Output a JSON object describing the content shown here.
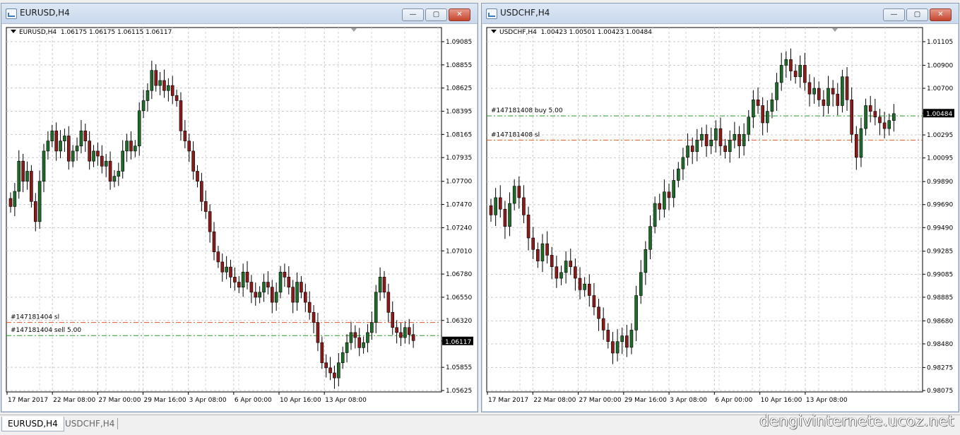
{
  "windows": [
    {
      "id": "eurusd",
      "title": "EURUSD,H4",
      "info_symbol": "EURUSD,H4",
      "info_ohlc": "1.06175 1.06175 1.06115 1.06117",
      "price_labels": [
        "1.09085",
        "1.08855",
        "1.08625",
        "1.08395",
        "1.08165",
        "1.07935",
        "1.07700",
        "1.07470",
        "1.07240",
        "1.07010",
        "1.06780",
        "1.06550",
        "1.06320",
        "1.06117",
        "1.05855",
        "1.05625"
      ],
      "price_min": 1.05625,
      "price_max": 1.09085,
      "current_price": "1.06117",
      "date_labels": [
        "17 Mar 2017",
        "22 Mar 08:00",
        "27 Mar 00:00",
        "29 Mar 16:00",
        "3 Apr 08:00",
        "6 Apr 00:00",
        "10 Apr 16:00",
        "13 Apr 08:00"
      ],
      "orders": [
        {
          "label": "#147181404 sl",
          "price": 1.063,
          "color": "#e8552e"
        },
        {
          "label": "#147181404 sell 5.00",
          "price": 1.0617,
          "color": "#2a9a2a"
        }
      ],
      "closes": [
        1.0745,
        1.076,
        1.079,
        1.077,
        1.078,
        1.075,
        1.073,
        1.077,
        1.08,
        1.081,
        1.082,
        1.08,
        1.081,
        1.0815,
        1.079,
        1.08,
        1.0805,
        1.082,
        1.081,
        1.079,
        1.08,
        1.0795,
        1.0785,
        1.079,
        1.077,
        1.0775,
        1.078,
        1.08,
        1.081,
        1.08,
        1.0805,
        1.084,
        1.085,
        1.086,
        1.088,
        1.0865,
        1.087,
        1.086,
        1.0865,
        1.0855,
        1.085,
        1.082,
        1.081,
        1.08,
        1.078,
        1.077,
        1.075,
        1.074,
        1.072,
        1.07,
        1.069,
        1.068,
        1.0685,
        1.0675,
        1.067,
        1.0665,
        1.068,
        1.067,
        1.066,
        1.0655,
        1.066,
        1.067,
        1.0665,
        1.065,
        1.066,
        1.068,
        1.0675,
        1.0665,
        1.065,
        1.067,
        1.066,
        1.065,
        1.064,
        1.063,
        1.061,
        1.059,
        1.0585,
        1.058,
        1.0575,
        1.059,
        1.06,
        1.061,
        1.062,
        1.0615,
        1.0605,
        1.061,
        1.062,
        1.063,
        1.066,
        1.0675,
        1.066,
        1.064,
        1.0625,
        1.062,
        1.0615,
        1.0625,
        1.0618,
        1.0612
      ]
    },
    {
      "id": "usdchf",
      "title": "USDCHF,H4",
      "info_symbol": "USDCHF,H4",
      "info_ohlc": "1.00423 1.00501 1.00423 1.00484",
      "price_labels": [
        "1.01105",
        "1.00900",
        "1.00700",
        "1.00484",
        "1.00295",
        "1.00095",
        "0.99890",
        "0.99690",
        "0.99490",
        "0.99285",
        "0.99085",
        "0.98885",
        "0.98680",
        "0.98480",
        "0.98275",
        "0.98075"
      ],
      "price_min": 0.98075,
      "price_max": 1.01105,
      "current_price": "1.00484",
      "date_labels": [
        "17 Mar 2017",
        "22 Mar 08:00",
        "27 Mar 00:00",
        "29 Mar 16:00",
        "3 Apr 08:00",
        "6 Apr 00:00",
        "10 Apr 16:00",
        "13 Apr 08:00"
      ],
      "orders": [
        {
          "label": "#147181408 buy 5.00",
          "price": 1.0046,
          "color": "#2a9a2a"
        },
        {
          "label": "#147181408 sl",
          "price": 1.0025,
          "color": "#e8552e"
        }
      ],
      "closes": [
        0.996,
        0.9975,
        0.9965,
        0.995,
        0.997,
        0.9985,
        0.9975,
        0.996,
        0.994,
        0.993,
        0.992,
        0.9935,
        0.9925,
        0.9915,
        0.9905,
        0.991,
        0.992,
        0.9915,
        0.9905,
        0.9895,
        0.99,
        0.989,
        0.988,
        0.987,
        0.986,
        0.985,
        0.984,
        0.985,
        0.9855,
        0.9845,
        0.986,
        0.989,
        0.991,
        0.993,
        0.995,
        0.997,
        0.9965,
        0.998,
        0.9975,
        0.999,
        1.0,
        1.001,
        1.002,
        1.0015,
        1.0025,
        1.003,
        1.002,
        1.0025,
        1.0035,
        1.002,
        1.0015,
        1.0025,
        1.003,
        1.002,
        1.003,
        1.0045,
        1.006,
        1.0055,
        1.004,
        1.005,
        1.006,
        1.0075,
        1.009,
        1.0095,
        1.0085,
        1.008,
        1.009,
        1.0075,
        1.0065,
        1.007,
        1.006,
        1.0055,
        1.007,
        1.0065,
        1.0055,
        1.008,
        1.006,
        1.003,
        1.001,
        1.0035,
        1.0055,
        1.005,
        1.0045,
        1.004,
        1.0035,
        1.0042,
        1.0048
      ]
    }
  ],
  "taskbar": {
    "tabs": [
      "EURUSD,H4",
      "USDCHF,H4"
    ],
    "watermark": "dengivinternete.ucoz.net"
  }
}
